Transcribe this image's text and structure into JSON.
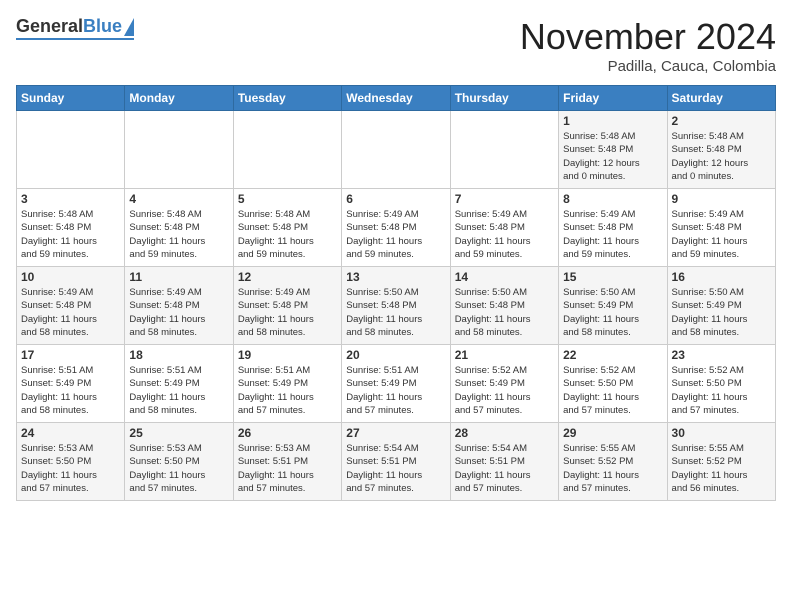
{
  "header": {
    "logo": {
      "general": "General",
      "blue": "Blue"
    },
    "title": "November 2024",
    "location": "Padilla, Cauca, Colombia"
  },
  "calendar": {
    "days_of_week": [
      "Sunday",
      "Monday",
      "Tuesday",
      "Wednesday",
      "Thursday",
      "Friday",
      "Saturday"
    ],
    "weeks": [
      [
        {
          "day": "",
          "info": ""
        },
        {
          "day": "",
          "info": ""
        },
        {
          "day": "",
          "info": ""
        },
        {
          "day": "",
          "info": ""
        },
        {
          "day": "",
          "info": ""
        },
        {
          "day": "1",
          "info": "Sunrise: 5:48 AM\nSunset: 5:48 PM\nDaylight: 12 hours\nand 0 minutes."
        },
        {
          "day": "2",
          "info": "Sunrise: 5:48 AM\nSunset: 5:48 PM\nDaylight: 12 hours\nand 0 minutes."
        }
      ],
      [
        {
          "day": "3",
          "info": "Sunrise: 5:48 AM\nSunset: 5:48 PM\nDaylight: 11 hours\nand 59 minutes."
        },
        {
          "day": "4",
          "info": "Sunrise: 5:48 AM\nSunset: 5:48 PM\nDaylight: 11 hours\nand 59 minutes."
        },
        {
          "day": "5",
          "info": "Sunrise: 5:48 AM\nSunset: 5:48 PM\nDaylight: 11 hours\nand 59 minutes."
        },
        {
          "day": "6",
          "info": "Sunrise: 5:49 AM\nSunset: 5:48 PM\nDaylight: 11 hours\nand 59 minutes."
        },
        {
          "day": "7",
          "info": "Sunrise: 5:49 AM\nSunset: 5:48 PM\nDaylight: 11 hours\nand 59 minutes."
        },
        {
          "day": "8",
          "info": "Sunrise: 5:49 AM\nSunset: 5:48 PM\nDaylight: 11 hours\nand 59 minutes."
        },
        {
          "day": "9",
          "info": "Sunrise: 5:49 AM\nSunset: 5:48 PM\nDaylight: 11 hours\nand 59 minutes."
        }
      ],
      [
        {
          "day": "10",
          "info": "Sunrise: 5:49 AM\nSunset: 5:48 PM\nDaylight: 11 hours\nand 58 minutes."
        },
        {
          "day": "11",
          "info": "Sunrise: 5:49 AM\nSunset: 5:48 PM\nDaylight: 11 hours\nand 58 minutes."
        },
        {
          "day": "12",
          "info": "Sunrise: 5:49 AM\nSunset: 5:48 PM\nDaylight: 11 hours\nand 58 minutes."
        },
        {
          "day": "13",
          "info": "Sunrise: 5:50 AM\nSunset: 5:48 PM\nDaylight: 11 hours\nand 58 minutes."
        },
        {
          "day": "14",
          "info": "Sunrise: 5:50 AM\nSunset: 5:48 PM\nDaylight: 11 hours\nand 58 minutes."
        },
        {
          "day": "15",
          "info": "Sunrise: 5:50 AM\nSunset: 5:49 PM\nDaylight: 11 hours\nand 58 minutes."
        },
        {
          "day": "16",
          "info": "Sunrise: 5:50 AM\nSunset: 5:49 PM\nDaylight: 11 hours\nand 58 minutes."
        }
      ],
      [
        {
          "day": "17",
          "info": "Sunrise: 5:51 AM\nSunset: 5:49 PM\nDaylight: 11 hours\nand 58 minutes."
        },
        {
          "day": "18",
          "info": "Sunrise: 5:51 AM\nSunset: 5:49 PM\nDaylight: 11 hours\nand 58 minutes."
        },
        {
          "day": "19",
          "info": "Sunrise: 5:51 AM\nSunset: 5:49 PM\nDaylight: 11 hours\nand 57 minutes."
        },
        {
          "day": "20",
          "info": "Sunrise: 5:51 AM\nSunset: 5:49 PM\nDaylight: 11 hours\nand 57 minutes."
        },
        {
          "day": "21",
          "info": "Sunrise: 5:52 AM\nSunset: 5:49 PM\nDaylight: 11 hours\nand 57 minutes."
        },
        {
          "day": "22",
          "info": "Sunrise: 5:52 AM\nSunset: 5:50 PM\nDaylight: 11 hours\nand 57 minutes."
        },
        {
          "day": "23",
          "info": "Sunrise: 5:52 AM\nSunset: 5:50 PM\nDaylight: 11 hours\nand 57 minutes."
        }
      ],
      [
        {
          "day": "24",
          "info": "Sunrise: 5:53 AM\nSunset: 5:50 PM\nDaylight: 11 hours\nand 57 minutes."
        },
        {
          "day": "25",
          "info": "Sunrise: 5:53 AM\nSunset: 5:50 PM\nDaylight: 11 hours\nand 57 minutes."
        },
        {
          "day": "26",
          "info": "Sunrise: 5:53 AM\nSunset: 5:51 PM\nDaylight: 11 hours\nand 57 minutes."
        },
        {
          "day": "27",
          "info": "Sunrise: 5:54 AM\nSunset: 5:51 PM\nDaylight: 11 hours\nand 57 minutes."
        },
        {
          "day": "28",
          "info": "Sunrise: 5:54 AM\nSunset: 5:51 PM\nDaylight: 11 hours\nand 57 minutes."
        },
        {
          "day": "29",
          "info": "Sunrise: 5:55 AM\nSunset: 5:52 PM\nDaylight: 11 hours\nand 57 minutes."
        },
        {
          "day": "30",
          "info": "Sunrise: 5:55 AM\nSunset: 5:52 PM\nDaylight: 11 hours\nand 56 minutes."
        }
      ]
    ]
  }
}
